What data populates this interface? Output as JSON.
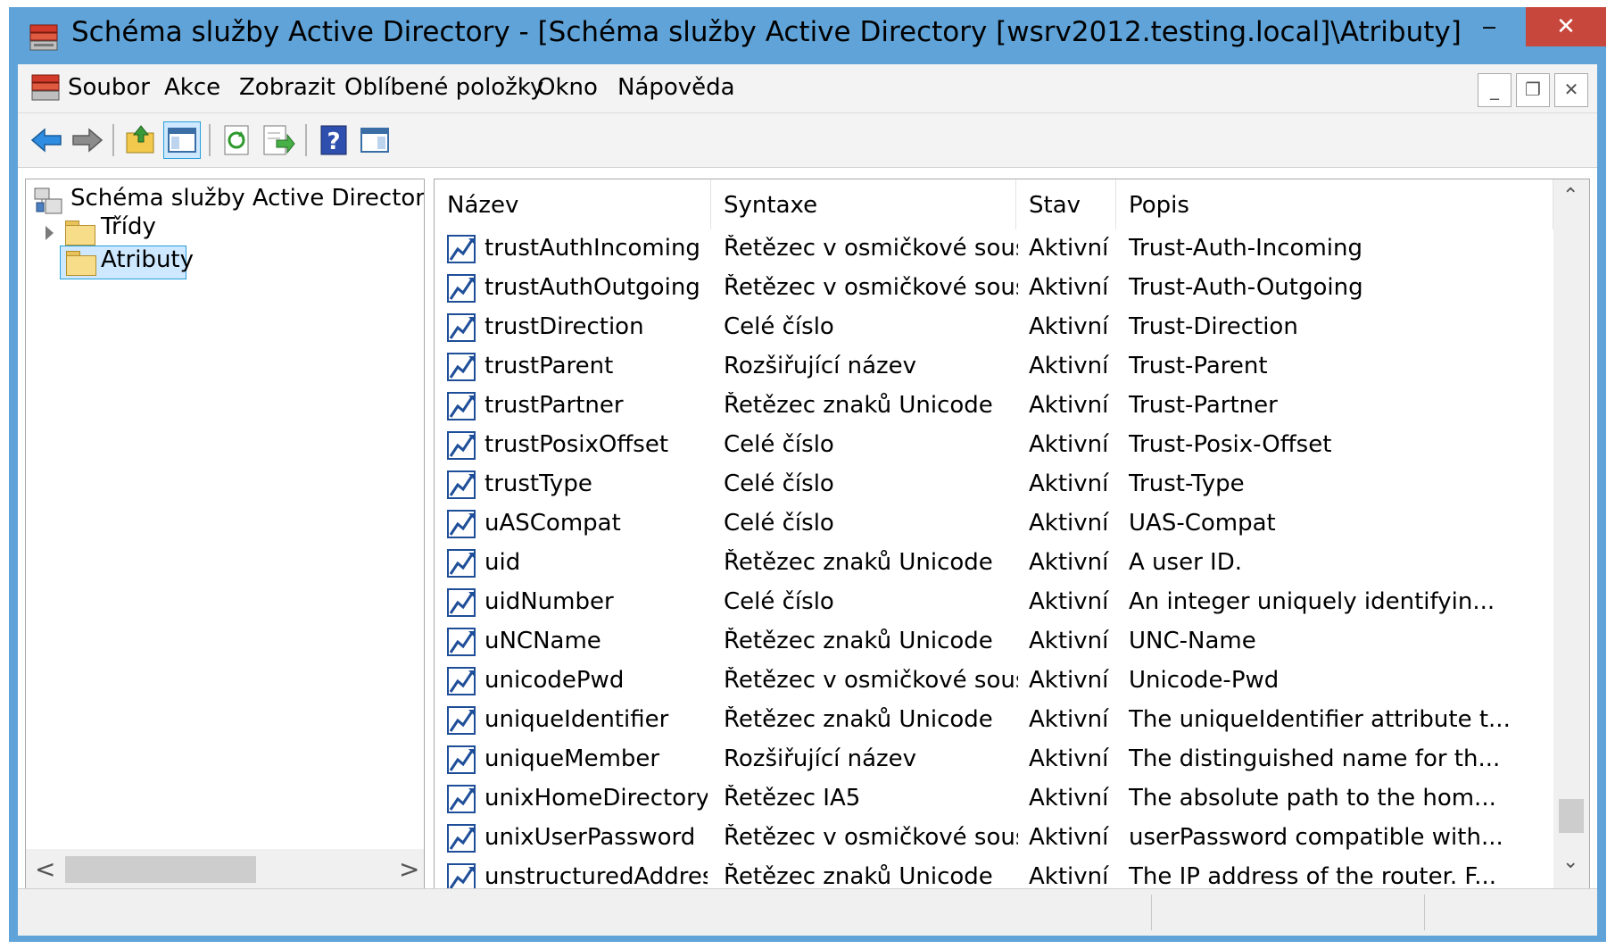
{
  "window": {
    "title": "Schéma služby Active Directory - [Schéma služby Active Directory [wsrv2012.testing.local]\\Atributy]",
    "minimize_label": "‒",
    "maximize_label": "☐",
    "close_label": "✕",
    "frame_color": "#5fa3d8",
    "close_color": "#c7473d"
  },
  "menu": {
    "items": [
      "Soubor",
      "Akce",
      "Zobrazit",
      "Oblíbené položky",
      "Okno",
      "Nápověda"
    ],
    "mdi": {
      "minimize": "_",
      "restore": "❐",
      "close": "✕"
    }
  },
  "toolbar": {
    "icons": [
      "back-icon",
      "forward-icon",
      "up-folder-icon",
      "show-hide-console-tree-icon",
      "refresh-icon",
      "export-list-icon",
      "help-icon",
      "show-hide-action-pane-icon"
    ]
  },
  "tree": {
    "root_label": "Schéma služby Active Directory",
    "items": [
      {
        "label": "Třídy",
        "expandable": true,
        "selected": false
      },
      {
        "label": "Atributy",
        "expandable": false,
        "selected": true
      }
    ],
    "scroll_left": "<",
    "scroll_right": ">"
  },
  "list": {
    "columns": [
      "Název",
      "Syntaxe",
      "Stav",
      "Popis"
    ],
    "rows": [
      [
        "trustAuthIncoming",
        "Řetězec v osmičkové soustavě",
        "Aktivní",
        "Trust-Auth-Incoming"
      ],
      [
        "trustAuthOutgoing",
        "Řetězec v osmičkové soustavě",
        "Aktivní",
        "Trust-Auth-Outgoing"
      ],
      [
        "trustDirection",
        "Celé číslo",
        "Aktivní",
        "Trust-Direction"
      ],
      [
        "trustParent",
        "Rozšiřující název",
        "Aktivní",
        "Trust-Parent"
      ],
      [
        "trustPartner",
        "Řetězec znaků Unicode",
        "Aktivní",
        "Trust-Partner"
      ],
      [
        "trustPosixOffset",
        "Celé číslo",
        "Aktivní",
        "Trust-Posix-Offset"
      ],
      [
        "trustType",
        "Celé číslo",
        "Aktivní",
        "Trust-Type"
      ],
      [
        "uASCompat",
        "Celé číslo",
        "Aktivní",
        "UAS-Compat"
      ],
      [
        "uid",
        "Řetězec znaků Unicode",
        "Aktivní",
        "A user ID."
      ],
      [
        "uidNumber",
        "Celé číslo",
        "Aktivní",
        "An integer uniquely identifyin..."
      ],
      [
        "uNCName",
        "Řetězec znaků Unicode",
        "Aktivní",
        "UNC-Name"
      ],
      [
        "unicodePwd",
        "Řetězec v osmičkové soustavě",
        "Aktivní",
        "Unicode-Pwd"
      ],
      [
        "uniqueIdentifier",
        "Řetězec znaků Unicode",
        "Aktivní",
        "The uniqueIdentifier attribute t..."
      ],
      [
        "uniqueMember",
        "Rozšiřující název",
        "Aktivní",
        "The distinguished name for th..."
      ],
      [
        "unixHomeDirectory",
        "Řetězec IA5",
        "Aktivní",
        "The absolute path to the hom..."
      ],
      [
        "unixUserPassword",
        "Řetězec v osmičkové soustavě",
        "Aktivní",
        "userPassword compatible with..."
      ],
      [
        "unstructuredAddress",
        "Řetězec znaků Unicode",
        "Aktivní",
        "The IP address of the router. F..."
      ]
    ],
    "scroll_up": "⌃",
    "scroll_down": "⌄"
  }
}
